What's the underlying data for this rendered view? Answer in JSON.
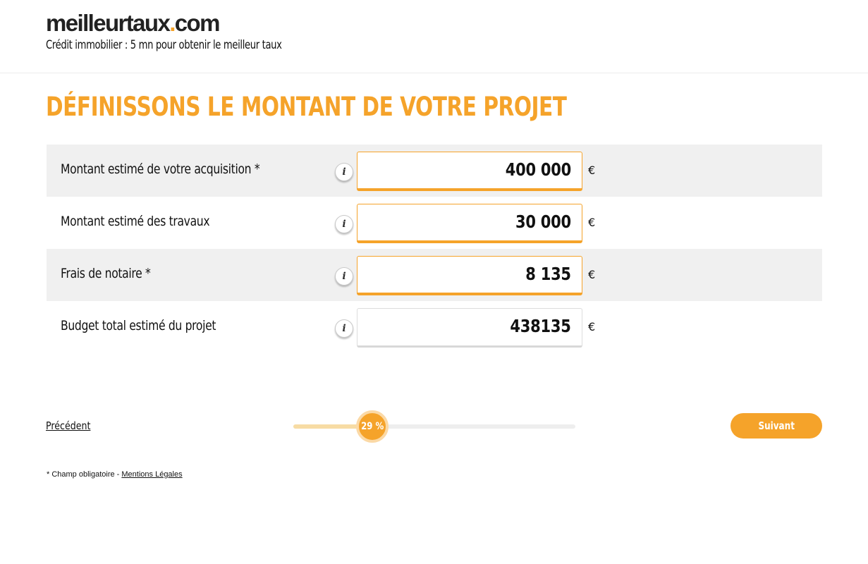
{
  "header": {
    "logo_main": "meilleurtaux",
    "logo_dot": ".",
    "logo_tld": "com",
    "tagline": "Crédit immobilier : 5 mn pour obtenir le meilleur taux"
  },
  "page_title": "DÉFINISSONS LE MONTANT DE VOTRE PROJET",
  "form": {
    "rows": [
      {
        "label": "Montant estimé de votre acquisition *",
        "info": "i",
        "value": "400 000",
        "currency": "€"
      },
      {
        "label": "Montant estimé des travaux",
        "info": "i",
        "value": "30 000",
        "currency": "€"
      },
      {
        "label": "Frais de notaire *",
        "info": "i",
        "value": "8 135",
        "currency": "€"
      },
      {
        "label": "Budget total estimé du projet",
        "info": "i",
        "value": "438135",
        "currency": "€"
      }
    ]
  },
  "navigation": {
    "previous_label": "Précédent",
    "next_label": "Suivant",
    "progress_text": "29 %",
    "progress_fraction": 0.28
  },
  "footer": {
    "required_note": "* Champ obligatoire - ",
    "legal_link": "Mentions Légales"
  },
  "colors": {
    "accent": "#f5a32a",
    "row_shade": "#f0f0f0",
    "progress_fill": "#f7dca4"
  },
  "icons": {
    "info": "info-icon"
  }
}
